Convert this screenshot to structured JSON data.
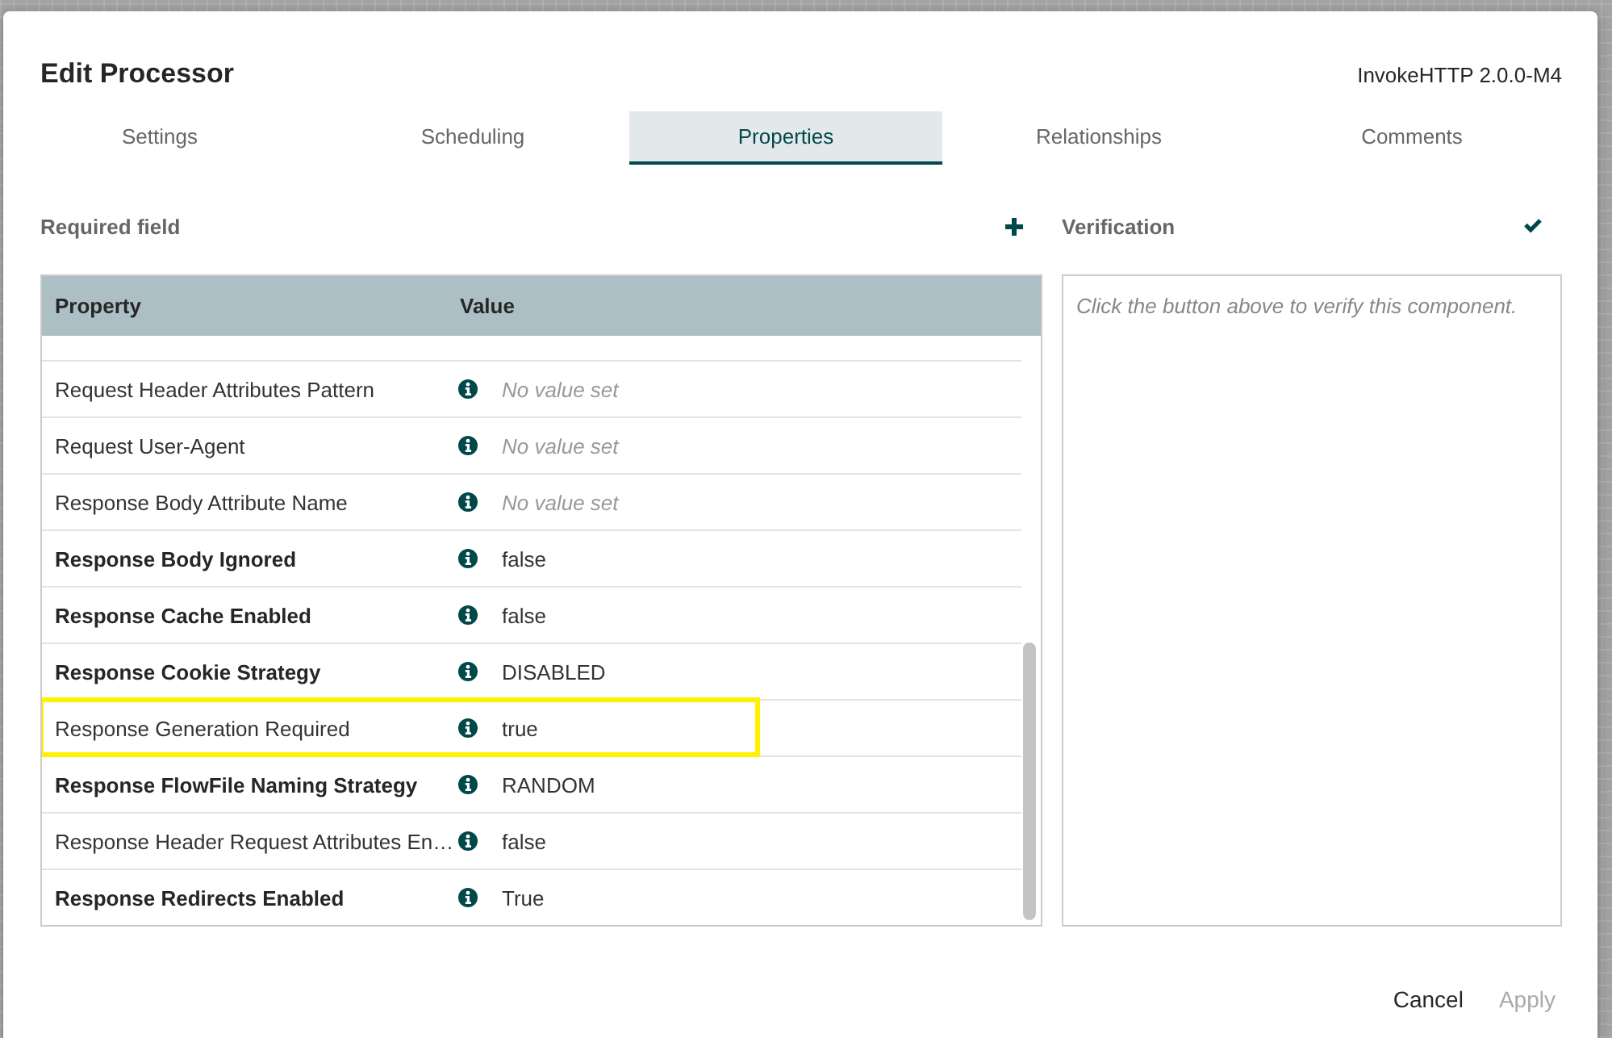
{
  "dialog": {
    "title": "Edit Processor",
    "component": "InvokeHTTP 2.0.0-M4"
  },
  "tabs": [
    {
      "label": "Settings",
      "selected": false
    },
    {
      "label": "Scheduling",
      "selected": false
    },
    {
      "label": "Properties",
      "selected": true
    },
    {
      "label": "Relationships",
      "selected": false
    },
    {
      "label": "Comments",
      "selected": false
    }
  ],
  "properties_panel": {
    "label": "Required field",
    "columns": [
      "Property",
      "Value"
    ],
    "rows": [
      {
        "name": "Request Header Attributes Pattern",
        "value": "No value set",
        "required": false,
        "empty": true,
        "highlighted": false
      },
      {
        "name": "Request User-Agent",
        "value": "No value set",
        "required": false,
        "empty": true,
        "highlighted": false
      },
      {
        "name": "Response Body Attribute Name",
        "value": "No value set",
        "required": false,
        "empty": true,
        "highlighted": false
      },
      {
        "name": "Response Body Ignored",
        "value": "false",
        "required": true,
        "empty": false,
        "highlighted": false
      },
      {
        "name": "Response Cache Enabled",
        "value": "false",
        "required": true,
        "empty": false,
        "highlighted": false
      },
      {
        "name": "Response Cookie Strategy",
        "value": "DISABLED",
        "required": true,
        "empty": false,
        "highlighted": false
      },
      {
        "name": "Response Generation Required",
        "value": "true",
        "required": false,
        "empty": false,
        "highlighted": true
      },
      {
        "name": "Response FlowFile Naming Strategy",
        "value": "RANDOM",
        "required": true,
        "empty": false,
        "highlighted": false
      },
      {
        "name": "Response Header Request Attributes En…",
        "value": "false",
        "required": false,
        "empty": false,
        "highlighted": false
      },
      {
        "name": "Response Redirects Enabled",
        "value": "True",
        "required": true,
        "empty": false,
        "highlighted": false
      }
    ]
  },
  "verification": {
    "label": "Verification",
    "message": "Click the button above to verify this component."
  },
  "buttons": [
    {
      "label": "Cancel",
      "disabled": false
    },
    {
      "label": "Apply",
      "disabled": true
    }
  ]
}
